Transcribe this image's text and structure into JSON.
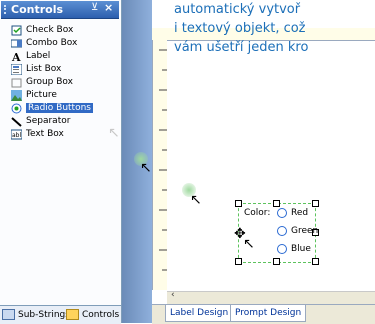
{
  "panel": {
    "title": "Controls",
    "pin": "⊻",
    "close": "×",
    "items": [
      {
        "label": "Check Box",
        "icon": "checkbox-icon"
      },
      {
        "label": "Combo Box",
        "icon": "combobox-icon"
      },
      {
        "label": "Label",
        "icon": "label-icon"
      },
      {
        "label": "List Box",
        "icon": "listbox-icon"
      },
      {
        "label": "Group Box",
        "icon": "groupbox-icon"
      },
      {
        "label": "Picture",
        "icon": "picture-icon"
      },
      {
        "label": "Radio Buttons",
        "icon": "radio-icon",
        "selected": true
      },
      {
        "label": "Separator",
        "icon": "separator-icon"
      },
      {
        "label": "Text Box",
        "icon": "textbox-icon"
      }
    ],
    "bottom_tabs": [
      "Sub-Strings",
      "Controls"
    ]
  },
  "designer": {
    "tabs": [
      "Label Design",
      "Prompt Design"
    ],
    "text_lines": [
      "automatický vytvoř",
      "i textový objekt, což",
      "vám ušetří jeden kro"
    ],
    "group_label": "Color:",
    "options": [
      "Red",
      "Green",
      "Blue"
    ]
  },
  "colors": {
    "accent": "#316ac5",
    "text_blue": "#1c6fb8",
    "dash_green": "#5dc35d"
  }
}
